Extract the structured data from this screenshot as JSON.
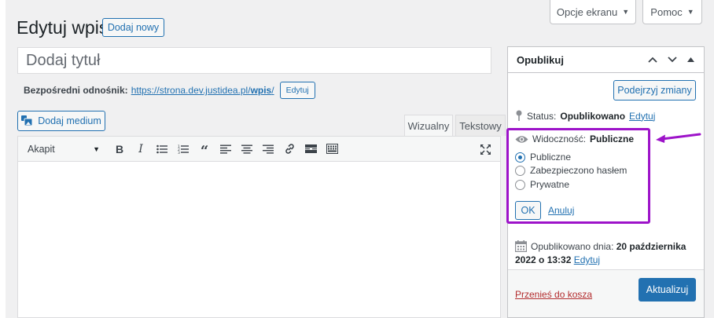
{
  "header": {
    "screen_options": "Opcje ekranu",
    "help": "Pomoc",
    "title": "Edytuj wpis",
    "add_new": "Dodaj nowy"
  },
  "post": {
    "title_placeholder": "Dodaj tytuł",
    "permalink_label": "Bezpośredni odnośnik:",
    "permalink_base": "https://strona.dev.justidea.pl/",
    "permalink_slug": "wpis",
    "permalink_suffix": "/",
    "permalink_edit": "Edytuj"
  },
  "editor": {
    "add_media": "Dodaj medium",
    "tab_visual": "Wizualny",
    "tab_text": "Tekstowy",
    "format_select": "Akapit",
    "toolbar_icons": [
      "bold-icon",
      "italic-icon",
      "bullet-list-icon",
      "numbered-list-icon",
      "blockquote-icon",
      "align-left-icon",
      "align-center-icon",
      "align-right-icon",
      "link-icon",
      "read-more-icon",
      "toolbar-toggle-icon",
      "fullscreen-icon"
    ]
  },
  "publish": {
    "title": "Opublikuj",
    "preview_button": "Podejrzyj zmiany",
    "status_label": "Status:",
    "status_value": "Opublikowano",
    "status_edit": "Edytuj",
    "visibility_label": "Widoczność:",
    "visibility_value": "Publiczne",
    "options": [
      "Publiczne",
      "Zabezpieczono hasłem",
      "Prywatne"
    ],
    "selected_option": "Publiczne",
    "ok": "OK",
    "cancel": "Anuluj",
    "published_label": "Opublikowano dnia:",
    "published_date": "20 października",
    "published_time": "2022 o 13:32",
    "published_edit": "Edytuj",
    "trash": "Przenieś do kosza",
    "update": "Aktualizuj"
  },
  "colors": {
    "accent": "#2271b1",
    "highlight": "#9d13c9",
    "trash": "#b32d2e",
    "background": "#f0f0f1"
  }
}
